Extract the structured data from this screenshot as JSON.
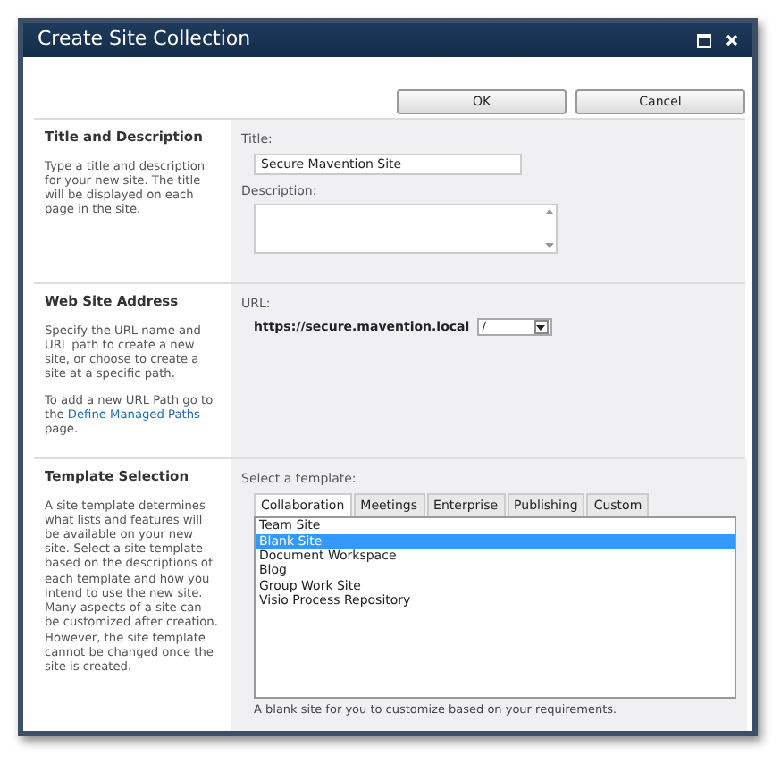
{
  "window": {
    "title": "Create Site Collection"
  },
  "buttons": [
    {
      "label": "OK"
    },
    {
      "label": "Cancel"
    }
  ],
  "sections": [
    {
      "kind": "title",
      "heading": "Title and Description",
      "help": [
        "Type a title and description for your new site. The title will be displayed on each page in the site."
      ],
      "title_label": "Title:",
      "title_value": "Secure Mavention Site",
      "description_label": "Description:"
    },
    {
      "kind": "url",
      "heading": "Web Site Address",
      "help": [
        "Specify the URL name and URL path to create a new site, or choose to create a site at a specific path."
      ],
      "link_paragraph": {
        "before": "To add a new URL Path go to the",
        "link": "Define Managed Paths",
        "after": "page."
      },
      "url_label": "URL:",
      "url_prefix": "https://secure.mavention.local",
      "path_value": "/"
    },
    {
      "kind": "template",
      "heading": "Template Selection",
      "help": [
        "A site template determines what lists and features will be available on your new site. Select a site template based on the descriptions of each template and how you intend to use the new site. Many aspects of a site can be customized after creation. However, the site template cannot be changed once the site is created."
      ],
      "select_label": "Select a template:",
      "tabs": [
        {
          "label": "Collaboration",
          "selected": true
        },
        {
          "label": "Meetings",
          "selected": false
        },
        {
          "label": "Enterprise",
          "selected": false
        },
        {
          "label": "Publishing",
          "selected": false
        },
        {
          "label": "Custom",
          "selected": false
        }
      ],
      "templates": [
        {
          "label": "Team Site",
          "selected": false
        },
        {
          "label": "Blank Site",
          "selected": true
        },
        {
          "label": "Document Workspace",
          "selected": false
        },
        {
          "label": "Blog",
          "selected": false
        },
        {
          "label": "Group Work Site",
          "selected": false
        },
        {
          "label": "Visio Process Repository",
          "selected": false
        }
      ],
      "template_description": "A blank site for you to customize based on your requirements."
    }
  ]
}
